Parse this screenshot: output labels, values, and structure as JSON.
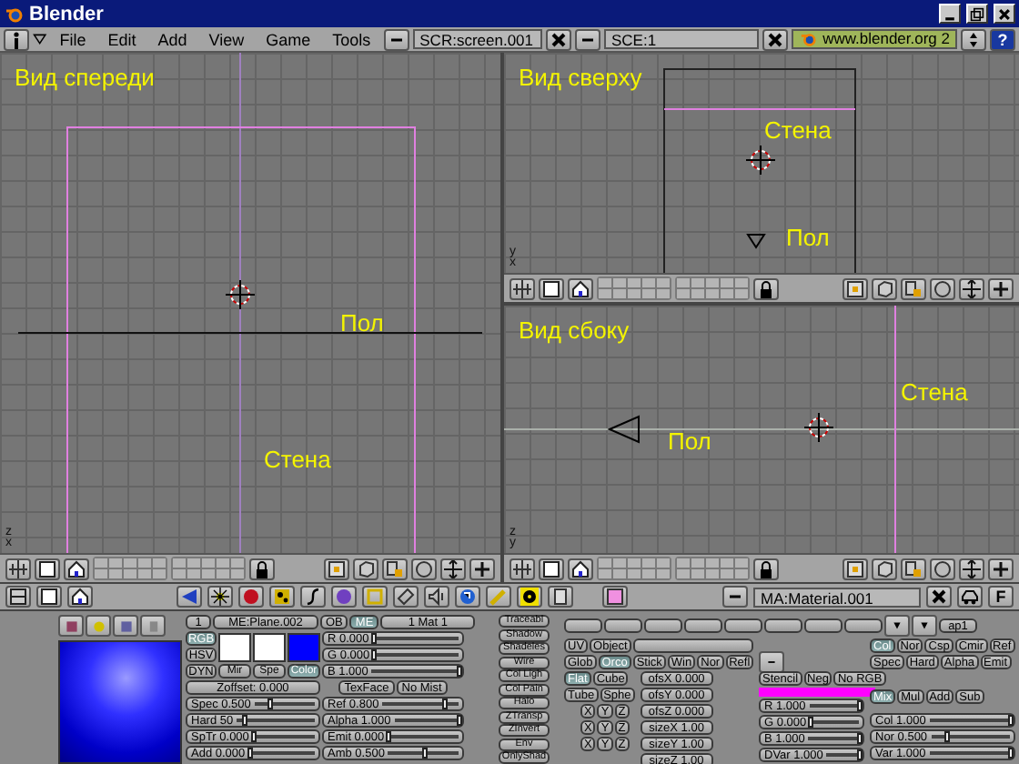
{
  "window": {
    "title": "Blender"
  },
  "menu": {
    "items": [
      "File",
      "Edit",
      "Add",
      "View",
      "Game",
      "Tools"
    ],
    "screen": "SCR:screen.001",
    "scene": "SCE:1",
    "url": "www.blender.org 2",
    "help": "?"
  },
  "viewports": [
    {
      "kind": "front",
      "title": "Вид спереди",
      "labels": [
        "Пол",
        "Стена"
      ],
      "axes": [
        "z",
        "x"
      ]
    },
    {
      "kind": "top",
      "title": "Вид сверху",
      "labels": [
        "Стена",
        "Пол"
      ],
      "axes": [
        "y",
        "x"
      ]
    },
    {
      "kind": "side",
      "title": "Вид сбоку",
      "labels": [
        "Стена",
        "Пол"
      ],
      "axes": [
        "z",
        "y"
      ]
    }
  ],
  "buttons_header": {
    "material": "MA:Material.001",
    "fake": "F"
  },
  "material": {
    "index": "1",
    "mesh": "ME:Plane.002",
    "link": [
      {
        "label": "OB",
        "selected": false
      },
      {
        "label": "ME",
        "selected": true
      }
    ],
    "mat": "1 Mat 1",
    "modes": [
      {
        "label": "RGB",
        "selected": true
      },
      {
        "label": "HSV",
        "selected": false
      },
      {
        "label": "DYN",
        "selected": false
      }
    ],
    "swatches": [
      {
        "label": "Mir",
        "selected": false,
        "color": "#ffffff"
      },
      {
        "label": "Spe",
        "selected": false,
        "color": "#ffffff"
      },
      {
        "label": "Color",
        "selected": true,
        "color": "#0000ff"
      }
    ],
    "rgb": [
      {
        "label": "R 0.000",
        "level": 0
      },
      {
        "label": "G 0.000",
        "level": 0
      },
      {
        "label": "B 1.000",
        "level": 1
      }
    ],
    "flags": [
      "TexFace",
      "No Mist"
    ],
    "zoffset": "Zoffset: 0.000",
    "left_sliders": [
      {
        "label": "Spec 0.500",
        "level": 0.25
      },
      {
        "label": "Hard 50",
        "level": 0.1
      },
      {
        "label": "SpTr 0.000",
        "level": 0
      },
      {
        "label": "Add 0.000",
        "level": 0
      }
    ],
    "right_sliders": [
      {
        "label": "Ref  0.800",
        "level": 0.8
      },
      {
        "label": "Alpha 1.000",
        "level": 1
      },
      {
        "label": "Emit 0.000",
        "level": 0
      },
      {
        "label": "Amb  0.500",
        "level": 0.5
      }
    ],
    "options": [
      "Traceabl",
      "Shadow",
      "Shadeles",
      "Wire",
      "Col Ligh",
      "Col Pain",
      "Halo",
      "ZTransp",
      "ZInvert",
      "Env",
      "OnlyShad"
    ]
  },
  "texture": {
    "channel": "ap1",
    "coords_a": [
      {
        "label": "UV",
        "selected": false
      },
      {
        "label": "Object",
        "selected": false
      }
    ],
    "coords_b": [
      {
        "label": "Glob",
        "selected": false
      },
      {
        "label": "Orco",
        "selected": true
      },
      {
        "label": "Stick",
        "selected": false
      },
      {
        "label": "Win",
        "selected": false
      },
      {
        "label": "Nor",
        "selected": false
      },
      {
        "label": "Refl",
        "selected": false
      }
    ],
    "mapping": [
      {
        "label": "Flat",
        "selected": true
      },
      {
        "label": "Cube",
        "selected": false
      },
      {
        "label": "Tube",
        "selected": false
      },
      {
        "label": "Sphe",
        "selected": false
      }
    ],
    "offsets": [
      "ofsX 0.000",
      "ofsY 0.000",
      "ofsZ 0.000"
    ],
    "axes_rows": [
      [
        "X",
        "Y",
        "Z"
      ],
      [
        "X",
        "Y",
        "Z"
      ],
      [
        "X",
        "Y",
        "Z"
      ]
    ],
    "sizes": [
      "sizeX 1.00",
      "sizeY 1.00",
      "sizeZ 1.00"
    ],
    "stencil": [
      {
        "label": "Stencil",
        "selected": false
      },
      {
        "label": "Neg",
        "selected": false
      },
      {
        "label": "No RGB",
        "selected": false
      }
    ],
    "tex_sliders": [
      {
        "label": "R 1.000",
        "level": 1
      },
      {
        "label": "G 0.000",
        "level": 0
      },
      {
        "label": "B 1.000",
        "level": 1
      },
      {
        "label": "DVar 1.000",
        "level": 1
      }
    ],
    "map_to": [
      {
        "label": "Col",
        "selected": true
      },
      {
        "label": "Nor",
        "selected": false
      },
      {
        "label": "Csp",
        "selected": false
      },
      {
        "label": "Cmir",
        "selected": false
      },
      {
        "label": "Ref",
        "selected": false
      },
      {
        "label": "Spec",
        "selected": false
      },
      {
        "label": "Hard",
        "selected": false
      },
      {
        "label": "Alpha",
        "selected": false
      },
      {
        "label": "Emit",
        "selected": false
      }
    ],
    "blend": [
      {
        "label": "Mix",
        "selected": true
      },
      {
        "label": "Mul",
        "selected": false
      },
      {
        "label": "Add",
        "selected": false
      },
      {
        "label": "Sub",
        "selected": false
      }
    ],
    "blend_sliders": [
      {
        "label": "Col 1.000",
        "level": 1
      },
      {
        "label": "Nor 0.500",
        "level": 0.2
      },
      {
        "label": "Var 1.000",
        "level": 1
      }
    ]
  }
}
